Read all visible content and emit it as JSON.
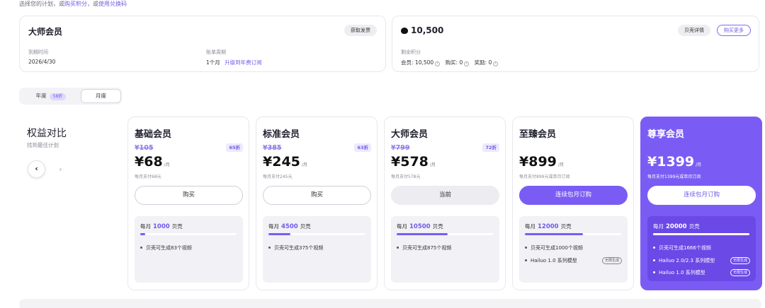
{
  "top_note": {
    "prefix": "选择您的计划，或",
    "buy_link": "购买积分",
    "mid": "，或",
    "redeem_link": "使用兑换码"
  },
  "membership": {
    "title": "大师会员",
    "invoice_button": "获取发票",
    "expiry_label": "到期时间",
    "expiry_value": "2026/4/30",
    "billing_label": "账单周期",
    "billing_value": "1个月",
    "upgrade_link": "升级到年费订阅"
  },
  "credits": {
    "balance": "10,500",
    "details_button": "贝壳详情",
    "buy_more_button": "购买更多",
    "remaining_label": "剩余积分",
    "member_label": "会员:",
    "member_value": "10,500",
    "purchase_label": "购买:",
    "purchase_value": "0",
    "reward_label": "奖励:",
    "reward_value": "0",
    "info_icon": "i"
  },
  "billing_toggle": {
    "year_label": "年度",
    "year_badge": "58折",
    "month_label": "月度",
    "selected": "月度"
  },
  "compare": {
    "title": "权益对比",
    "subtitle": "找到最佳计划",
    "prev": "‹",
    "next": "›"
  },
  "plans": [
    {
      "name": "基础会员",
      "original_price": "¥105",
      "discount": "65折",
      "price": "¥68",
      "unit": "/月",
      "note": "每月支付68元",
      "button": "购买",
      "quota_prefix": "每月",
      "quota": "1000",
      "quota_suffix": "贝壳",
      "quota_fill": 0.05,
      "features": [
        "贝壳可生成83个视频"
      ],
      "tags": []
    },
    {
      "name": "标准会员",
      "original_price": "¥385",
      "discount": "63折",
      "price": "¥245",
      "unit": "/月",
      "note": "每月支付245元",
      "button": "购买",
      "quota_prefix": "每月",
      "quota": "4500",
      "quota_suffix": "贝壳",
      "quota_fill": 0.23,
      "features": [
        "贝壳可生成375个视频"
      ],
      "tags": []
    },
    {
      "name": "大师会员",
      "original_price": "¥799",
      "discount": "72折",
      "price": "¥578",
      "unit": "/月",
      "note": "每月支付578元",
      "button": "当前",
      "quota_prefix": "每月",
      "quota": "10500",
      "quota_suffix": "贝壳",
      "quota_fill": 0.53,
      "features": [
        "贝壳可生成875个视频"
      ],
      "tags": []
    },
    {
      "name": "至臻会员",
      "price": "¥899",
      "unit": "/月",
      "note": "每月支付899元或单月订阅",
      "button": "连续包月订购",
      "quota_prefix": "每月",
      "quota": "12000",
      "quota_suffix": "贝壳",
      "quota_fill": 0.6,
      "features": [
        "贝壳可生成1000个视频",
        "Hailuo 1.0 系列模型"
      ],
      "tags": [
        "",
        "无限生成"
      ]
    },
    {
      "name": "尊享会员",
      "price": "¥1399",
      "unit": "/月",
      "note": "每月支付1399元或单月订阅",
      "button": "连续包月订购",
      "quota_prefix": "每月",
      "quota": "20000",
      "quota_suffix": "贝壳",
      "quota_fill": 1.0,
      "features": [
        "贝壳可生成1666个视频",
        "Hailuo 2.0/2.3 系列模型",
        "Hailuo 1.0 系列模型"
      ],
      "tags": [
        "",
        "无限生成",
        "无限生成"
      ]
    }
  ],
  "colors": {
    "accent": "#7a5cf5",
    "accent_text": "#6f5ce8",
    "muted": "#8b8b98"
  },
  "icons": {
    "shell": "shell-icon",
    "prev": "chevron-left-icon",
    "next": "chevron-right-icon"
  }
}
